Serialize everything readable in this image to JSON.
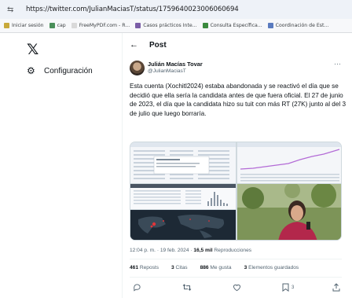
{
  "browser": {
    "url": "https://twitter.com/JulianMaciasT/status/1759640023006060694",
    "bookmarks": [
      {
        "label": "Iniciar sesión",
        "color": "#c8a93b"
      },
      {
        "label": "cap",
        "color": "#4a8f5a"
      },
      {
        "label": "FreeMyPDF.com - R...",
        "color": "#d9d9d9"
      },
      {
        "label": "Casos prácticos Inte...",
        "color": "#7b5ea7"
      },
      {
        "label": "Consulta Específica...",
        "color": "#3b8a3e"
      },
      {
        "label": "Coordinación de Est...",
        "color": "#5a7bbf"
      }
    ]
  },
  "nav": {
    "logo": "𝕏",
    "config_label": "Configuración"
  },
  "header": {
    "back": "←",
    "title": "Post"
  },
  "tweet": {
    "author_name": "Julián Macías Tovar",
    "author_handle": "@JulianMaciasT",
    "more": "···",
    "text": "Esta cuenta (Xochitl2024) estaba abandonada y se reactivó el día que se decidió que ella sería la candidata antes de que fuera oficial. El 27 de junio de 2023, el día que la candidata hizo su tuit con más RT (27K) junto al del 3 de julio que luego borraría.",
    "time": "12:04 p. m. · 19 feb. 2024 · ",
    "views": "16,5 mil",
    "views_label": " Reproducciones"
  },
  "stats": {
    "reposts_count": "461",
    "reposts_label": " Reposts",
    "quotes_count": "3",
    "quotes_label": " Citas",
    "likes_count": "886",
    "likes_label": " Me gusta",
    "bookmarks_count": "3",
    "bookmarks_label": " Elementos guardados"
  },
  "actions": {
    "reply_icon": "reply-icon",
    "repost_icon": "repost-icon",
    "like_icon": "heart-icon",
    "bookmark_icon": "bookmark-icon",
    "bookmark_count": "3",
    "share_icon": "share-icon"
  }
}
